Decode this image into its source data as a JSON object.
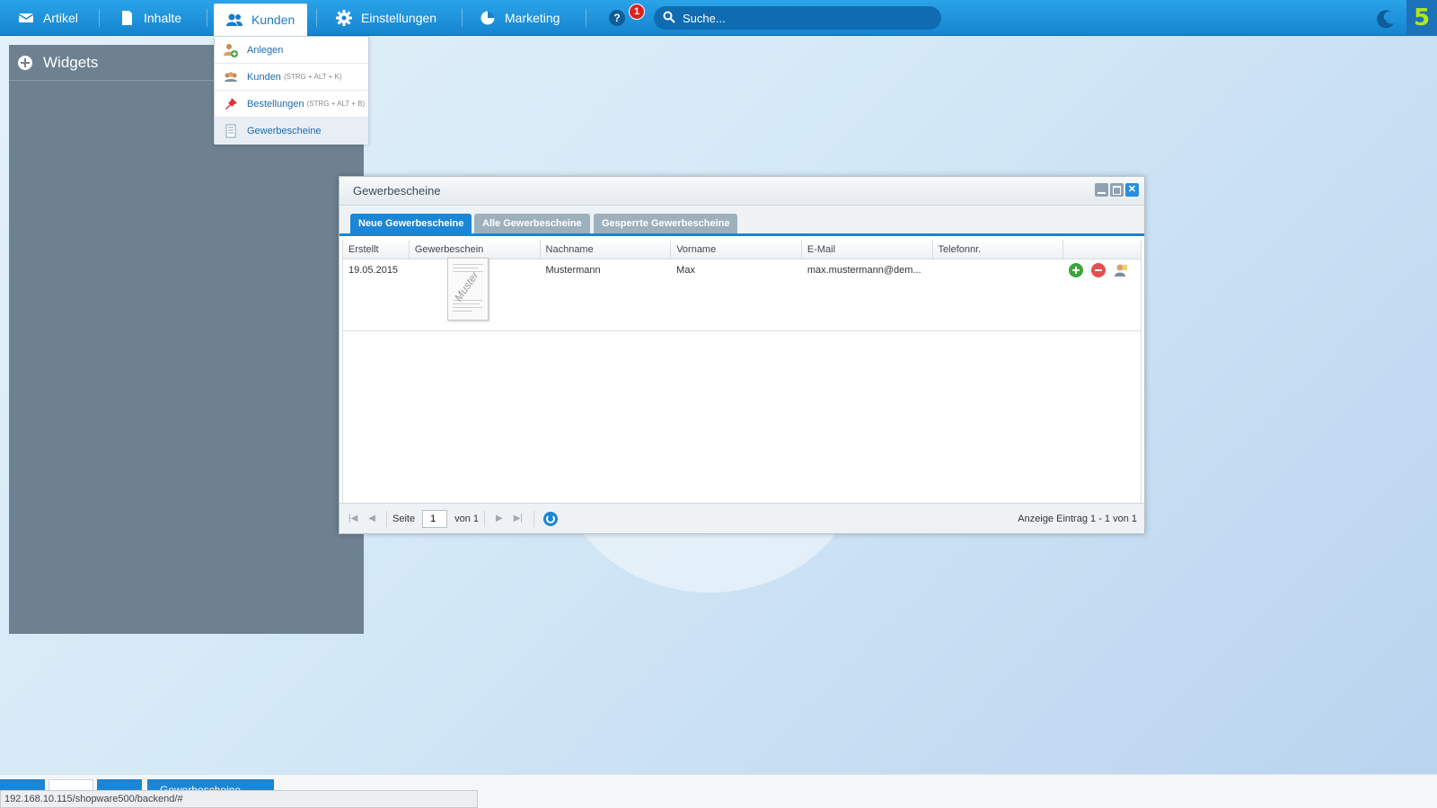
{
  "topbar": {
    "nav": [
      {
        "label": "Artikel",
        "icon": "artikel-icon"
      },
      {
        "label": "Inhalte",
        "icon": "inhalte-icon"
      },
      {
        "label": "Kunden",
        "icon": "kunden-icon",
        "active": true
      },
      {
        "label": "Einstellungen",
        "icon": "gear-icon"
      },
      {
        "label": "Marketing",
        "icon": "pie-chart-icon"
      }
    ],
    "help_label": "?",
    "notification_count": "1",
    "search_placeholder": "Suche..."
  },
  "widgets": {
    "title": "Widgets"
  },
  "dropdown": {
    "items": [
      {
        "label": "Anlegen",
        "shortcut": ""
      },
      {
        "label": "Kunden",
        "shortcut": "(STRG + ALT + K)"
      },
      {
        "label": "Bestellungen",
        "shortcut": "(STRG + ALT + B)"
      },
      {
        "label": "Gewerbescheine",
        "shortcut": ""
      }
    ]
  },
  "window": {
    "title": "Gewerbescheine",
    "tabs": [
      "Neue Gewerbescheine",
      "Alle Gewerbescheine",
      "Gesperrte Gewerbescheine"
    ],
    "columns": [
      "Erstellt",
      "Gewerbeschein",
      "Nachname",
      "Vorname",
      "E-Mail",
      "Telefonnr.",
      ""
    ],
    "rows": [
      {
        "erstellt": "19.05.2015",
        "thumb_stamp": "Muster",
        "nachname": "Mustermann",
        "vorname": "Max",
        "email": "max.mustermann@dem...",
        "telefon": ""
      }
    ],
    "pager": {
      "page_label": "Seite",
      "page_value": "1",
      "of_label": "von 1",
      "info": "Anzeige Eintrag 1 - 1 von 1"
    }
  },
  "taskbar": {
    "window_label": "Gewerbescheine"
  },
  "status_url": "192.168.10.115/shopware500/backend/#",
  "colors": {
    "accent": "#1b86d6",
    "topbar": "#1584cf",
    "widgets_bg": "#6d8190",
    "logo_green": "#b6e51a"
  }
}
